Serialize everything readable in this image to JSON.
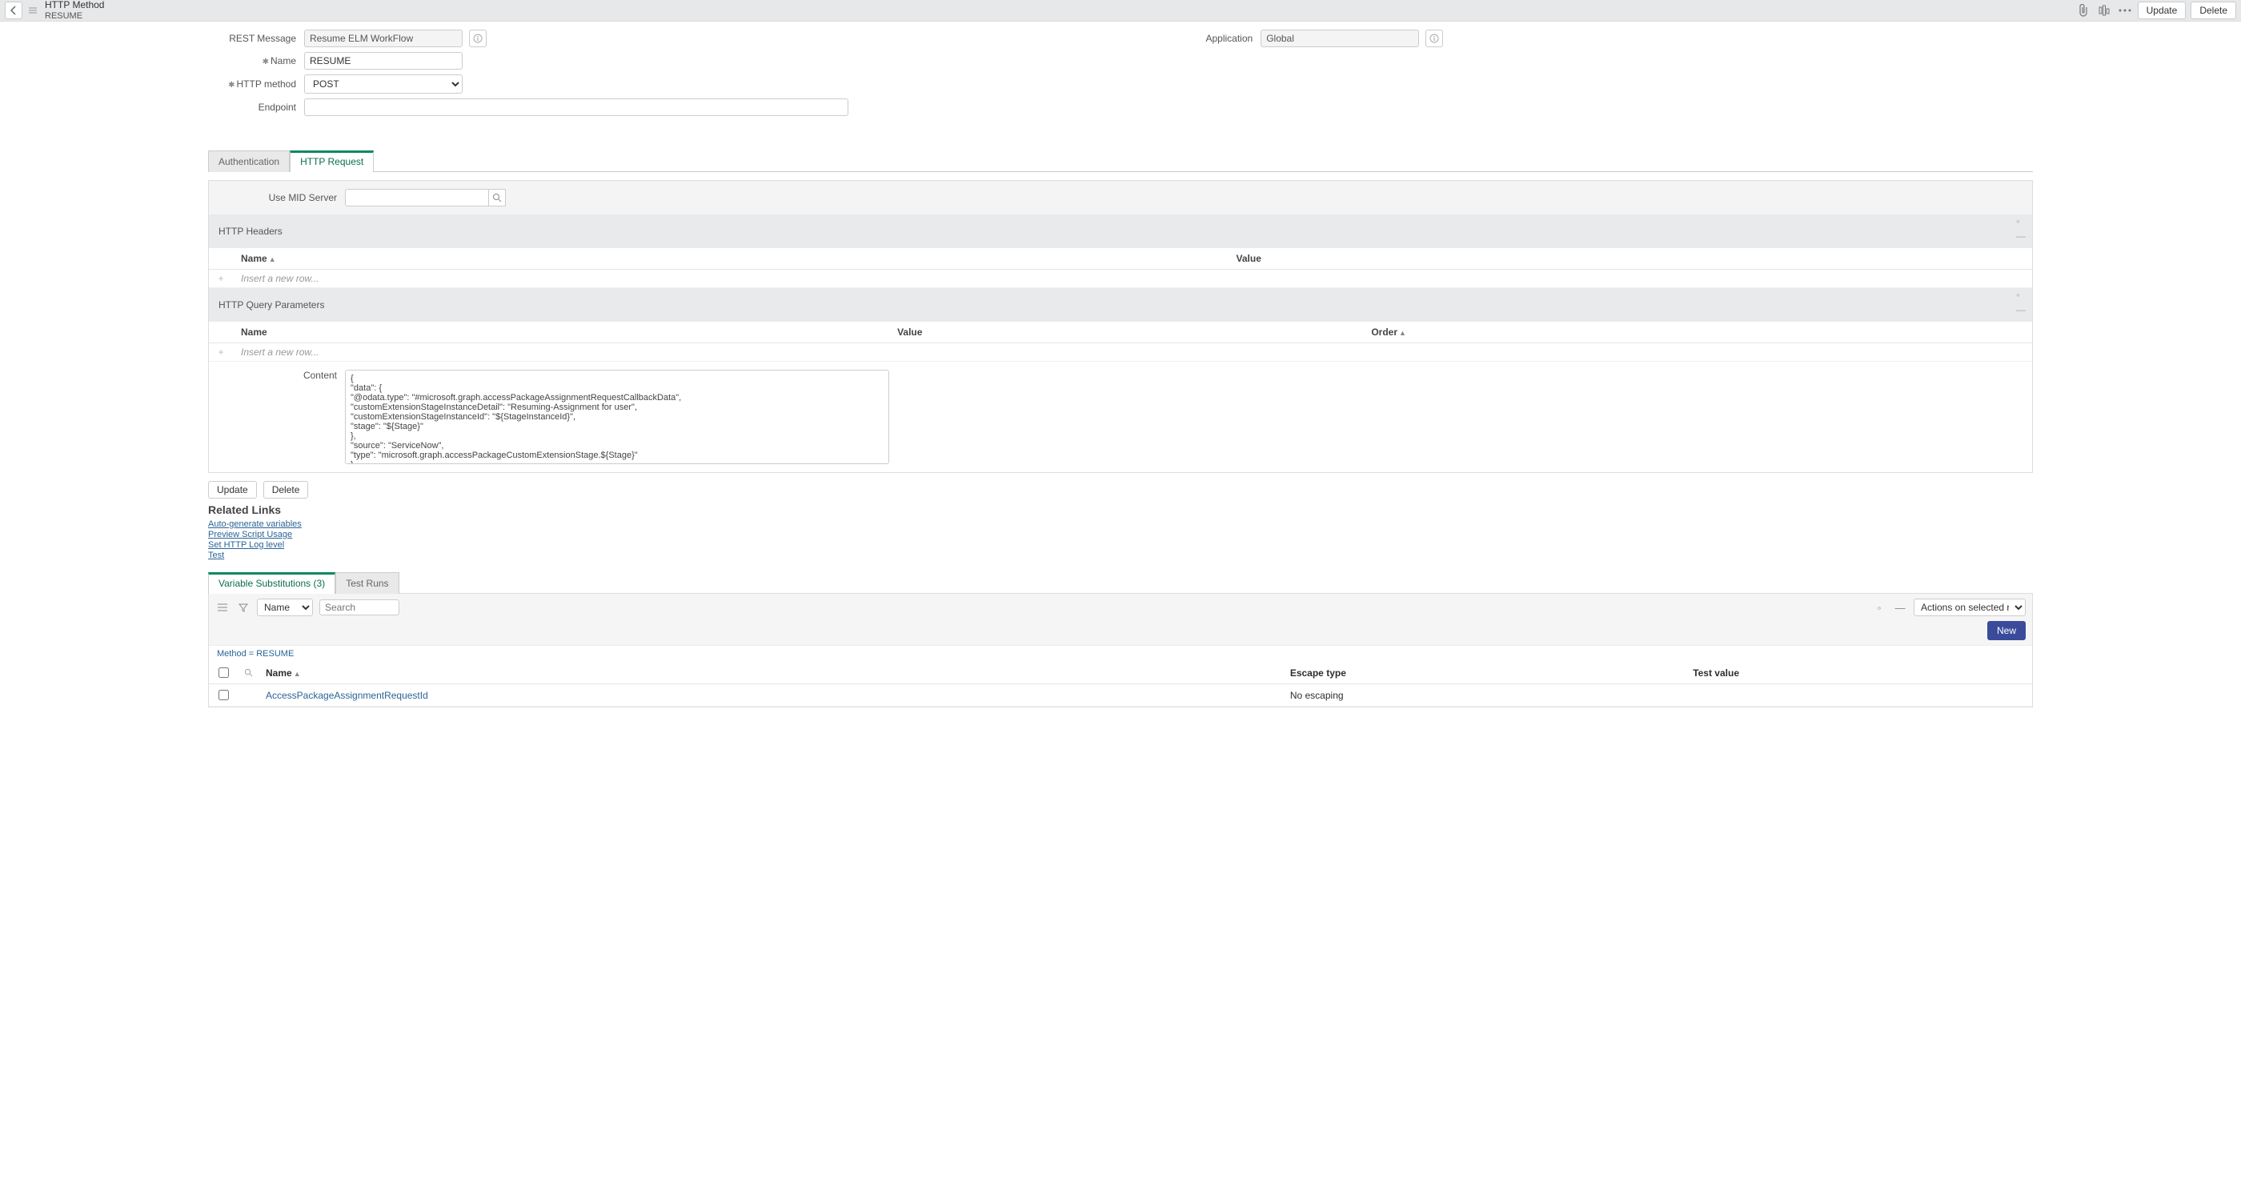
{
  "header": {
    "title": "HTTP Method",
    "subtitle": "RESUME",
    "buttons": {
      "update": "Update",
      "delete": "Delete"
    }
  },
  "form": {
    "rest_message": {
      "label": "REST Message",
      "value": "Resume ELM WorkFlow"
    },
    "name": {
      "label": "Name",
      "value": "RESUME"
    },
    "http_method": {
      "label": "HTTP method",
      "value": "POST"
    },
    "endpoint": {
      "label": "Endpoint",
      "value": ""
    },
    "application": {
      "label": "Application",
      "value": "Global"
    }
  },
  "tabs": {
    "auth": "Authentication",
    "http_request": "HTTP Request"
  },
  "mid": {
    "label": "Use MID Server",
    "value": ""
  },
  "headers_section": {
    "title": "HTTP Headers",
    "cols": {
      "name": "Name",
      "value": "Value"
    },
    "placeholder": "Insert a new row..."
  },
  "params_section": {
    "title": "HTTP Query Parameters",
    "cols": {
      "name": "Name",
      "value": "Value",
      "order": "Order"
    },
    "placeholder": "Insert a new row..."
  },
  "content": {
    "label": "Content",
    "value": "{\n\"data\": {\n\"@odata.type\": \"#microsoft.graph.accessPackageAssignmentRequestCallbackData\",\n\"customExtensionStageInstanceDetail\": \"Resuming-Assignment for user\",\n\"customExtensionStageInstanceId\": \"${StageInstanceId}\",\n\"stage\": \"${Stage}\"\n},\n\"source\": \"ServiceNow\",\n\"type\": \"microsoft.graph.accessPackageCustomExtensionStage.${Stage}\"\n}"
  },
  "below": {
    "update": "Update",
    "delete": "Delete"
  },
  "related_links": {
    "title": "Related Links",
    "items": [
      "Auto-generate variables",
      "Preview Script Usage",
      "Set HTTP Log level",
      "Test"
    ]
  },
  "related_tabs": {
    "varsubs": "Variable Substitutions (3)",
    "testruns": "Test Runs"
  },
  "rel_toolbar": {
    "search_by": "Name",
    "search_placeholder": "Search",
    "actions": "Actions on selected rows...",
    "new_btn": "New"
  },
  "breadcrumb": "Method = RESUME",
  "rel_table": {
    "cols": {
      "name": "Name",
      "escape": "Escape type",
      "test": "Test value"
    },
    "rows": [
      {
        "name": "AccessPackageAssignmentRequestId",
        "escape": "No escaping",
        "test": ""
      }
    ]
  }
}
